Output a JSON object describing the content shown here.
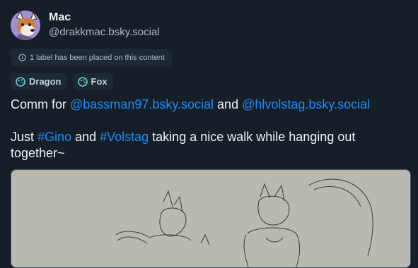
{
  "author": {
    "display_name": "Mac",
    "handle": "@drakkmac.bsky.social"
  },
  "moderation_label": {
    "icon": "info-icon",
    "text": "1 label has been placed on this content"
  },
  "tags": [
    {
      "icon": "palette-icon",
      "label": "Dragon"
    },
    {
      "icon": "palette-icon",
      "label": "Fox"
    }
  ],
  "post": {
    "line1_prefix": "Comm for ",
    "mention1": "@bassman97.bsky.social",
    "line1_middle": " and ",
    "mention2": "@hlvolstag.bsky.social",
    "line2_prefix": "Just ",
    "hashtag1": "#Gino",
    "line2_middle": " and ",
    "hashtag2": "#Volstag",
    "line2_suffix": " taking a nice walk while hanging out together~"
  },
  "colors": {
    "background": "#161e27",
    "link": "#1f8cf9",
    "secondary_text": "#aebbc9"
  }
}
